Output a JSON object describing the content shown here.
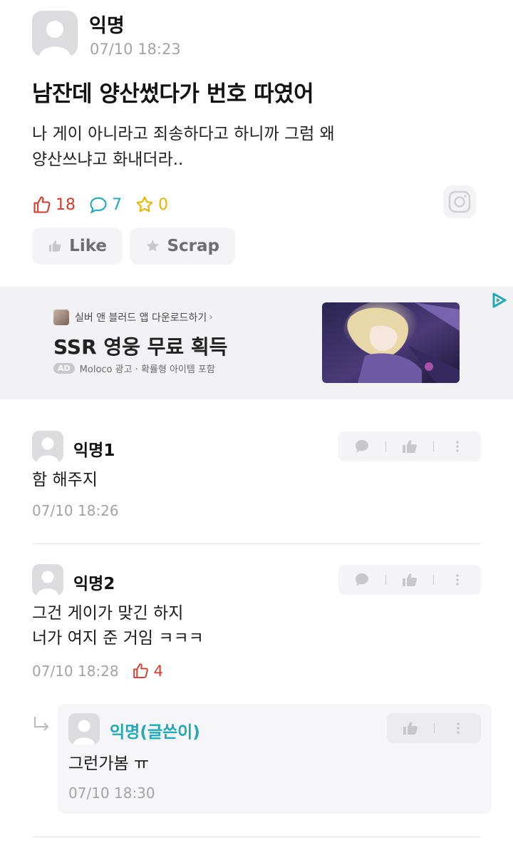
{
  "post": {
    "author": "익명",
    "time": "07/10 18:23",
    "title": "남잔데 양산썼다가 번호 따였어",
    "body_line1": "나 게이 아니라고 죄송하다고 하니까 그럼 왜",
    "body_line2": "양산쓰냐고 화내더라..",
    "likes": "18",
    "comments": "7",
    "scraps": "0",
    "like_label": "Like",
    "scrap_label": "Scrap"
  },
  "ad": {
    "app_line": "실버 앤 블러드 앱 다운로드하기",
    "headline": "SSR 영웅 무료 획득",
    "badge": "AD",
    "meta": "Moloco 광고 · 확률형 아이템 포함"
  },
  "comments": [
    {
      "author": "익명1",
      "text_lines": [
        "함 해주지"
      ],
      "time": "07/10 18:26"
    },
    {
      "author": "익명2",
      "text_lines": [
        "그건 게이가 맞긴 하지",
        "너가 여지 준 거임 ㅋㅋㅋ"
      ],
      "time": "07/10 18:28",
      "likes": "4"
    }
  ],
  "reply": {
    "author": "익명(글쓴이)",
    "text": "그런가봄 ㅠ",
    "time": "07/10 18:30"
  },
  "colors": {
    "like": "#d33b2c",
    "comment": "#1fa9b9",
    "scrap": "#e9b400",
    "writer_name": "#1fa9b9",
    "muted": "#a3a3a8"
  },
  "icons": [
    "thumbs-up-icon",
    "speech-bubble-icon",
    "star-icon",
    "instagram-icon",
    "adchoices-icon",
    "more-vertical-icon",
    "reply-arrow-icon"
  ]
}
